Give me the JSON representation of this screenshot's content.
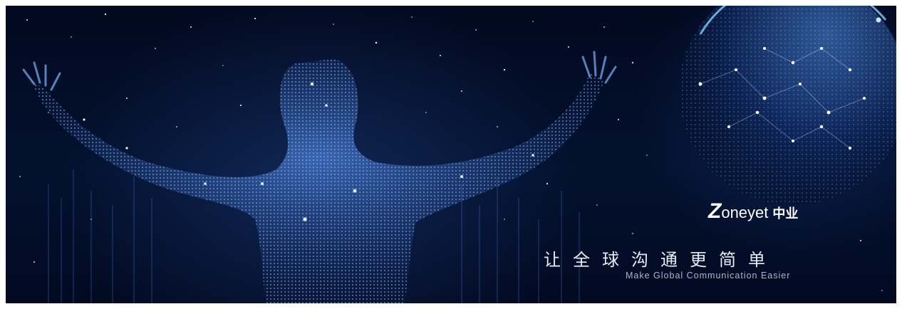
{
  "brand": {
    "logo_mark": "Z",
    "name": "oneyet",
    "name_cn": "中业"
  },
  "slogan": {
    "cn": "让全球沟通更简单",
    "en": "Make Global Communication Easier"
  },
  "colors": {
    "background": "#03112e",
    "accent_blue": "#5fa8ff",
    "text": "#ffffff"
  }
}
